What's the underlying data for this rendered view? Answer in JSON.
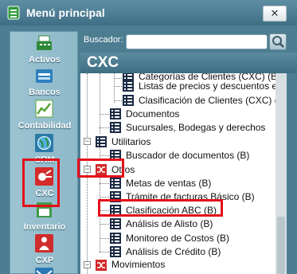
{
  "window": {
    "title": "Menú principal",
    "close_label": "✕"
  },
  "sidebar": {
    "items": [
      {
        "label": "Activos",
        "icon": "cash-register-icon",
        "color": "#2e8a3a"
      },
      {
        "label": "Bancos",
        "icon": "bank-building-icon",
        "color": "#2f7fbf"
      },
      {
        "label": "Contabilidad",
        "icon": "ledger-chart-icon",
        "color": "#5aa33a"
      },
      {
        "label": "CRM",
        "icon": "globe-icon",
        "color": "#2a7aa8"
      },
      {
        "label": "CXC",
        "icon": "receivable-bag-icon",
        "color": "#d42a2a"
      },
      {
        "label": "Inventario",
        "icon": "inventory-box-icon",
        "color": "#3f9b48"
      },
      {
        "label": "CXP",
        "icon": "payable-person-icon",
        "color": "#cf2b2b"
      },
      {
        "label": "",
        "icon": "mail-icon",
        "color": "#2c78b4"
      }
    ]
  },
  "search": {
    "label": "Buscador:",
    "value": "",
    "placeholder": ""
  },
  "section": {
    "title": "CXC"
  },
  "tree": {
    "rows": [
      {
        "text": "Categorías de Clientes (CXC) (B)",
        "type": "leaf"
      },
      {
        "text": "Listas de precios y descuentos e",
        "type": "leaf"
      },
      {
        "text": "Clasificación de Clientes (CXC) (",
        "type": "leaf"
      },
      {
        "text": "Documentos",
        "type": "leaf"
      },
      {
        "text": "Sucursales, Bodegas y derechos",
        "type": "leaf"
      },
      {
        "text": "Utilitarios",
        "type": "folder",
        "expanded": true
      },
      {
        "text": "Buscador de documentos (B)",
        "type": "leaf"
      },
      {
        "text": "Otros",
        "type": "folder-red",
        "expanded": true
      },
      {
        "text": "Metas de ventas (B)",
        "type": "leaf"
      },
      {
        "text": "Trámite de facturas Básico (B)",
        "type": "leaf"
      },
      {
        "text": "Clasificación ABC (B)",
        "type": "leaf"
      },
      {
        "text": "Análisis de Alisto (B)",
        "type": "leaf"
      },
      {
        "text": "Monitoreo de Costos (B)",
        "type": "leaf"
      },
      {
        "text": "Análisis de Crédito (B)",
        "type": "leaf"
      },
      {
        "text": "Movimientos",
        "type": "folder-red",
        "expanded": true
      }
    ]
  },
  "colors": {
    "highlight": "#e3101a",
    "titlebar": "#4d7d91",
    "tree_icon": "#1b2a44"
  }
}
